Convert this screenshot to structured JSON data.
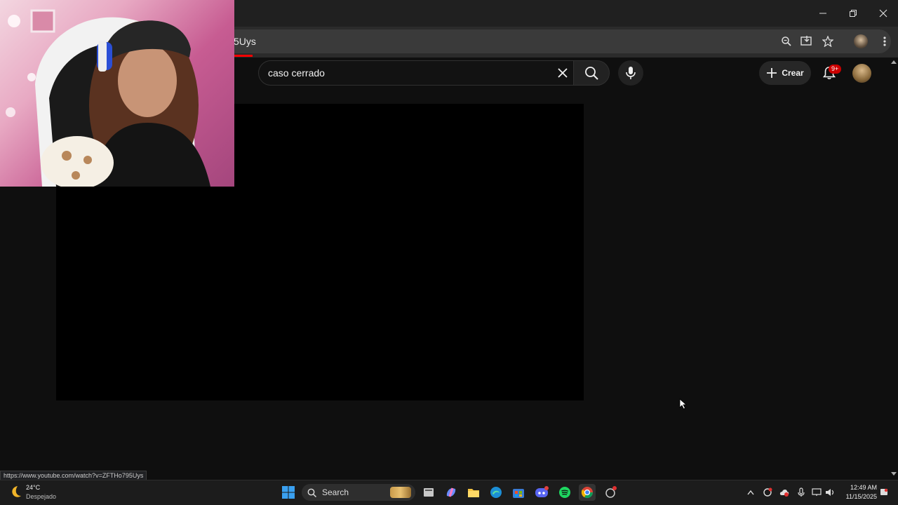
{
  "browser": {
    "url_fragment": "5Uys",
    "status_url": "https://www.youtube.com/watch?v=ZFTHo795Uys"
  },
  "youtube": {
    "search_query": "caso cerrado",
    "create_label": "Crear",
    "notification_badge": "9+"
  },
  "taskbar": {
    "weather_temp": "24°C",
    "weather_desc": "Despejado",
    "search_label": "Search",
    "time": "12:49 AM",
    "date": "11/15/2025"
  },
  "colors": {
    "youtube_bg": "#0f0f0f",
    "badge": "#cc0000",
    "accent_red": "#ff0000"
  }
}
